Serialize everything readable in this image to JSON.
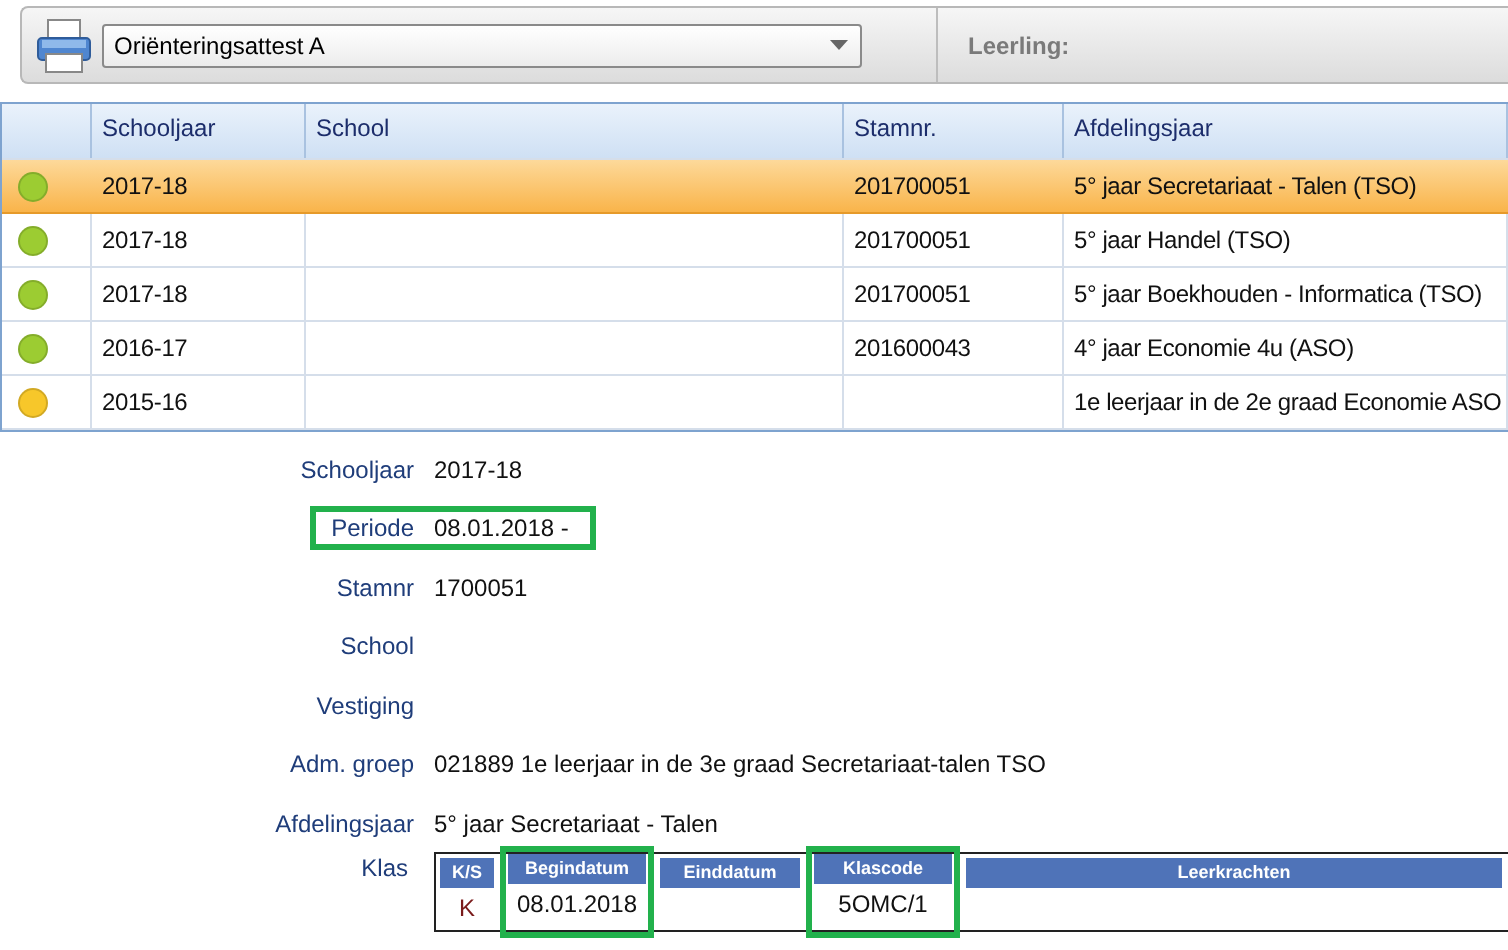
{
  "toolbar": {
    "report_select": {
      "value": "Oriënteringsattest A"
    },
    "student_label": "Leerling:"
  },
  "table": {
    "columns": [
      "Schooljaar",
      "School",
      "Stamnr.",
      "Afdelingsjaar"
    ],
    "rows": [
      {
        "selected": true,
        "color": "#9ccc32",
        "cells": [
          "2017-18",
          "",
          "201700051",
          "5° jaar Secretariaat - Talen (TSO)"
        ]
      },
      {
        "selected": false,
        "color": "#9ccc32",
        "cells": [
          "2017-18",
          "",
          "201700051",
          "5° jaar Handel (TSO)"
        ]
      },
      {
        "selected": false,
        "color": "#9ccc32",
        "cells": [
          "2017-18",
          "",
          "201700051",
          "5° jaar Boekhouden - Informatica (TSO)"
        ]
      },
      {
        "selected": false,
        "color": "#9ccc32",
        "cells": [
          "2016-17",
          "",
          "201600043",
          "4° jaar Economie 4u (ASO)"
        ]
      },
      {
        "selected": false,
        "color": "#f7c72a",
        "cells": [
          "2015-16",
          "",
          "",
          "1e leerjaar in de 2e graad Economie ASO"
        ]
      }
    ]
  },
  "details": [
    {
      "label": "Schooljaar",
      "value": "2017-18",
      "highlighted": false
    },
    {
      "label": "Periode",
      "value": "08.01.2018 -",
      "highlighted": true
    },
    {
      "label": "Stamnr",
      "value": "1700051",
      "highlighted": false
    },
    {
      "label": "School",
      "highlighted": false
    },
    {
      "label": "Vestiging",
      "highlighted": false
    },
    {
      "label": "Adm. groep",
      "value": "021889  1e leerjaar in de 3e graad Secretariaat-talen TSO",
      "highlighted": false
    },
    {
      "label": "Afdelingsjaar",
      "value": "5° jaar Secretariaat - Talen",
      "highlighted": false
    }
  ],
  "klas": {
    "label": "Klas",
    "columns": [
      {
        "header": "K/S",
        "value": "K",
        "highlighted": false
      },
      {
        "header": "Begindatum",
        "value": "08.01.2018",
        "highlighted": true
      },
      {
        "header": "Einddatum",
        "highlighted": false
      },
      {
        "header": "Klascode",
        "value": "5OMC/1",
        "highlighted": true
      },
      {
        "header": "Leerkrachten",
        "highlighted": false
      }
    ]
  }
}
